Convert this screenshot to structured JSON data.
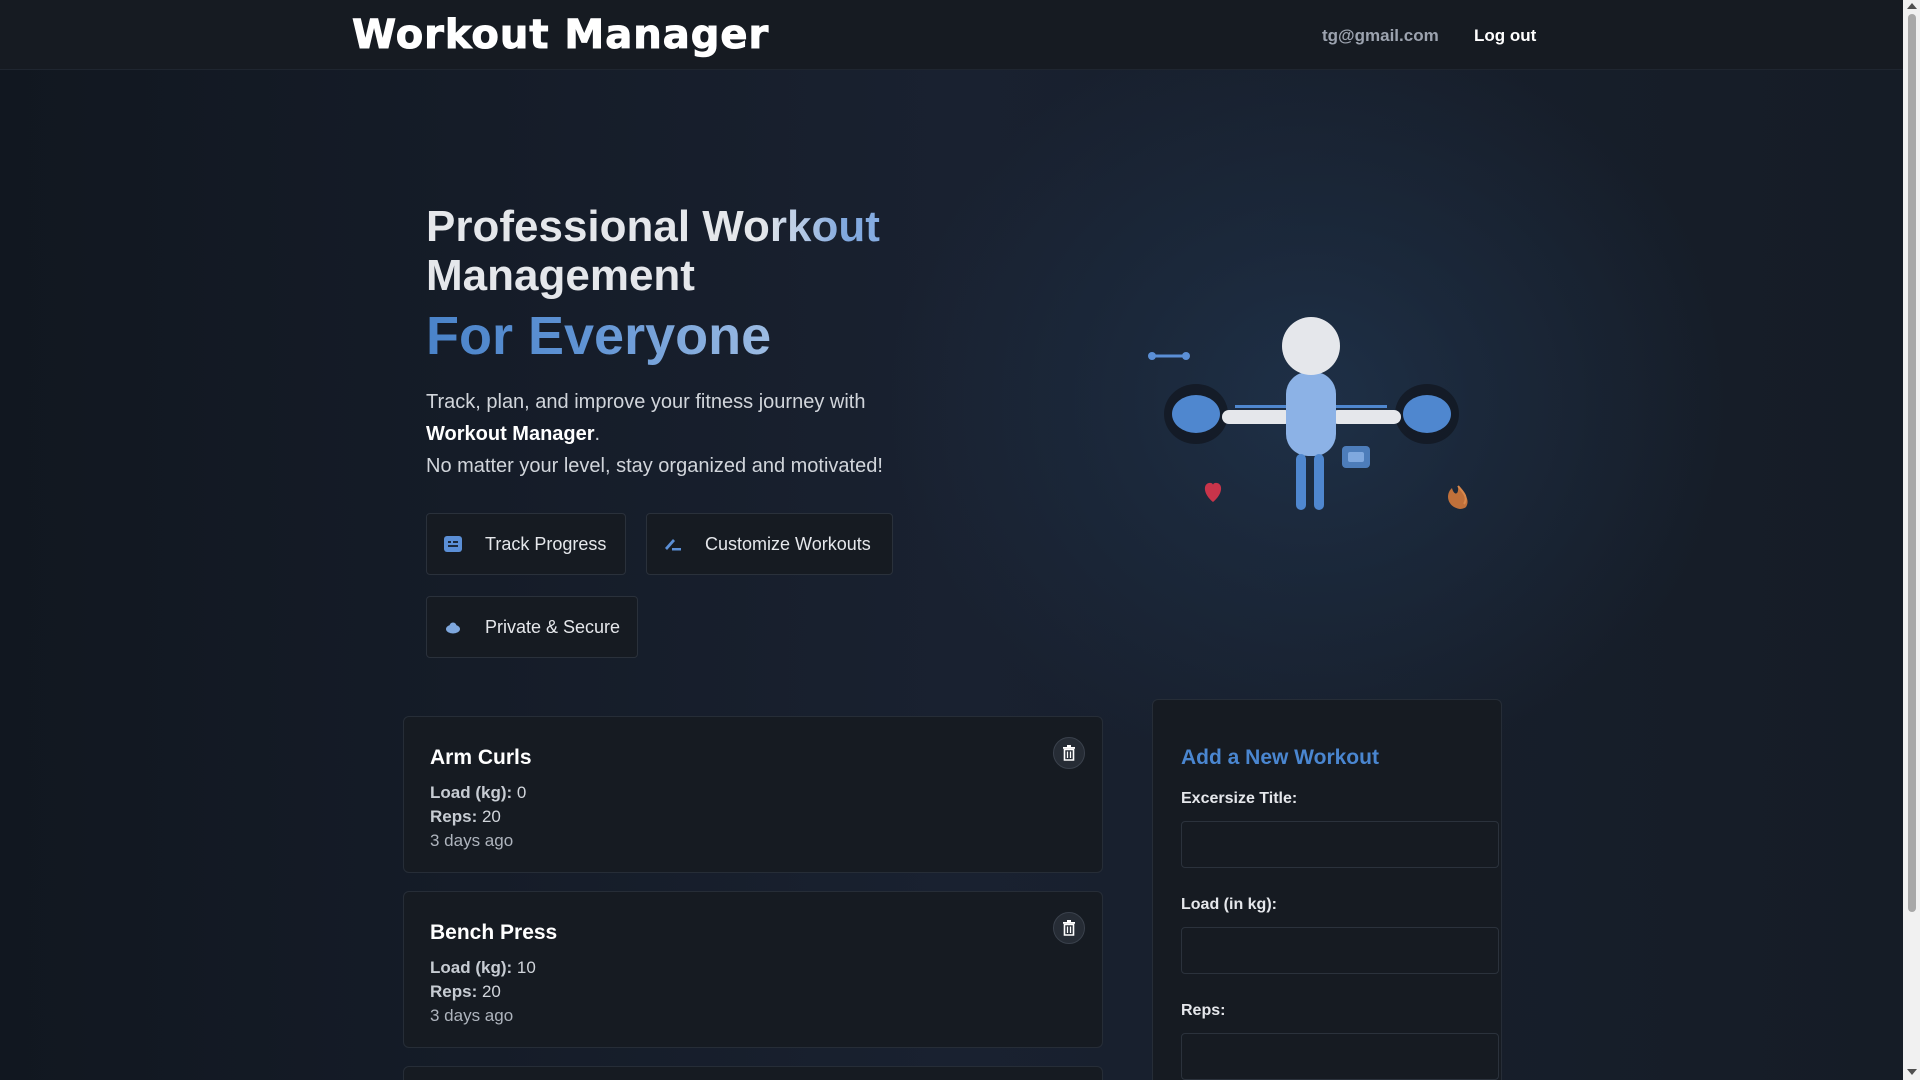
{
  "navbar": {
    "brand": "Workout Manager",
    "user_email": "tg@gmail.com",
    "logout_label": "Log out"
  },
  "hero": {
    "title_line1": "Professional Workout",
    "title_line2": "Management",
    "subtitle": "For Everyone",
    "description_part1": "Track, plan, and improve your fitness journey with",
    "description_brand": "Workout Manager",
    "description_part2": ".",
    "description_line3": "No matter your level, stay organized and motivated!",
    "features": [
      {
        "label": "Track Progress",
        "icon": "chart-icon"
      },
      {
        "label": "Customize Workouts",
        "icon": "pencil-icon"
      },
      {
        "label": "Private & Secure",
        "icon": "cloud-lock-icon"
      }
    ]
  },
  "workouts": [
    {
      "title": "Arm Curls",
      "load_label": "Load (kg):",
      "load": "0",
      "reps_label": "Reps:",
      "reps": "20",
      "time": "3 days ago"
    },
    {
      "title": "Bench Press",
      "load_label": "Load (kg):",
      "load": "10",
      "reps_label": "Reps:",
      "reps": "20",
      "time": "3 days ago"
    }
  ],
  "form": {
    "heading": "Add a New Workout",
    "title_label": "Excersize Title:",
    "title_value": "",
    "load_label": "Load (in kg):",
    "load_value": "",
    "reps_label": "Reps:",
    "reps_value": ""
  },
  "colors": {
    "accent": "#4a86d0",
    "navbar_bg": "#161b22",
    "card_bg": "#161b22",
    "figure_blue": "#5b8fd6",
    "heart": "#c9344a",
    "flame": "#c0703a"
  }
}
